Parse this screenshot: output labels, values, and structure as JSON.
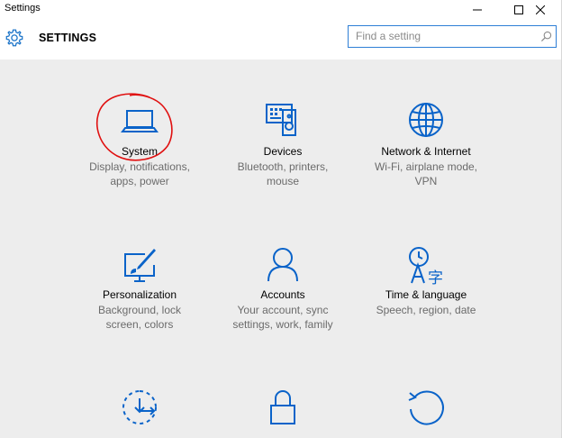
{
  "window": {
    "title": "Settings",
    "controls": {
      "minimize": "minimize-icon",
      "maximize": "maximize-icon",
      "close": "close-icon"
    }
  },
  "header": {
    "icon": "gear-icon",
    "title": "SETTINGS"
  },
  "search": {
    "placeholder": "Find a setting",
    "value": "",
    "icon": "search-icon"
  },
  "accent_color": "#0078d7",
  "annotation_color": "#e01010",
  "tiles": [
    {
      "icon": "laptop-icon",
      "name": "System",
      "desc1": "Display, notifications,",
      "desc2": "apps, power"
    },
    {
      "icon": "devices-icon",
      "name": "Devices",
      "desc1": "Bluetooth, printers,",
      "desc2": "mouse"
    },
    {
      "icon": "globe-icon",
      "name": "Network & Internet",
      "desc1": "Wi-Fi, airplane mode,",
      "desc2": "VPN"
    },
    {
      "icon": "paint-icon",
      "name": "Personalization",
      "desc1": "Background, lock",
      "desc2": "screen, colors"
    },
    {
      "icon": "person-icon",
      "name": "Accounts",
      "desc1": "Your account, sync",
      "desc2": "settings, work, family"
    },
    {
      "icon": "time-language-icon",
      "name": "Time & language",
      "desc1": "Speech, region, date",
      "desc2": ""
    },
    {
      "icon": "ease-of-access-icon",
      "name": "",
      "desc1": "",
      "desc2": ""
    },
    {
      "icon": "lock-icon",
      "name": "",
      "desc1": "",
      "desc2": ""
    },
    {
      "icon": "update-icon",
      "name": "",
      "desc1": "",
      "desc2": ""
    }
  ]
}
